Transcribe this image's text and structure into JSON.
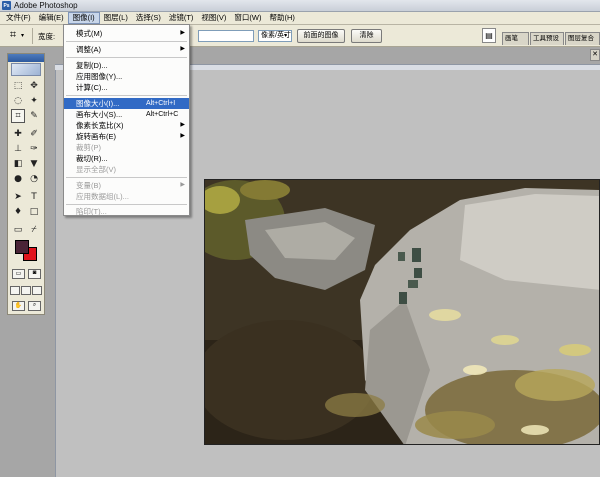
{
  "window": {
    "title": "Adobe Photoshop"
  },
  "menubar": {
    "items": [
      "文件(F)",
      "编辑(E)",
      "图像(I)",
      "图层(L)",
      "选择(S)",
      "滤镜(T)",
      "视图(V)",
      "窗口(W)",
      "帮助(H)"
    ],
    "active_index": 2
  },
  "options_bar": {
    "width_label": "宽度:",
    "resolution_unit": "像素/英寸",
    "front_image_button": "前面的图像",
    "clear_button": "清除",
    "well_tabs": [
      "画笔",
      "工具预设",
      "图层复合"
    ]
  },
  "image_menu": {
    "items": [
      {
        "label": "模式(M)",
        "submenu": true,
        "disabled": false
      },
      {
        "label": "调整(A)",
        "submenu": true,
        "disabled": false
      },
      {
        "label": "复制(D)...",
        "disabled": false
      },
      {
        "label": "应用图像(Y)...",
        "disabled": false
      },
      {
        "label": "计算(C)...",
        "disabled": false
      },
      {
        "label": "图像大小(I)...",
        "shortcut": "Alt+Ctrl+I",
        "disabled": false,
        "highlighted": true
      },
      {
        "label": "画布大小(S)...",
        "shortcut": "Alt+Ctrl+C",
        "disabled": false
      },
      {
        "label": "像素长宽比(X)",
        "submenu": true,
        "disabled": false
      },
      {
        "label": "旋转画布(E)",
        "submenu": true,
        "disabled": false
      },
      {
        "label": "裁剪(P)",
        "disabled": true
      },
      {
        "label": "裁切(R)...",
        "disabled": false
      },
      {
        "label": "显示全部(V)",
        "disabled": true
      },
      {
        "label": "变量(B)",
        "submenu": true,
        "disabled": true
      },
      {
        "label": "应用数据组(L)...",
        "disabled": true
      },
      {
        "label": "陷印(T)...",
        "disabled": true
      }
    ]
  },
  "colors": {
    "foreground": "#4a2436",
    "background": "#e0141c",
    "menu_highlight": "#316ac5"
  },
  "icons": {
    "toolbox": [
      "marquee-icon",
      "move-icon",
      "lasso-icon",
      "magic-wand-icon",
      "crop-icon",
      "slice-icon",
      "healing-brush-icon",
      "brush-icon",
      "clone-stamp-icon",
      "history-brush-icon",
      "eraser-icon",
      "paint-bucket-icon",
      "blur-icon",
      "dodge-icon",
      "path-selection-icon",
      "type-icon",
      "pen-icon",
      "shape-icon",
      "notes-icon",
      "eyedropper-icon",
      "hand-icon",
      "zoom-icon"
    ]
  }
}
